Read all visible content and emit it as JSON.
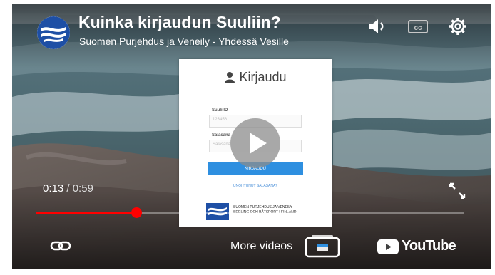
{
  "video": {
    "title": "Kuinka kirjaudun Suuliin?",
    "channel": "Suomen Purjehdus ja Veneily - Yhdessä Vesille"
  },
  "login_card": {
    "heading": "Kirjaudu",
    "field1_label": "Suuli ID",
    "field1_value": "123456",
    "field2_label": "Salasana",
    "field2_placeholder": "Salasana",
    "submit_label": "KIRJAUDU",
    "forgot_link": "UNOHTUNUT SALASANA?",
    "footer_line1": "SUOMEN PURJEHDUS JA VENEILY",
    "footer_line2": "SEGLING OCH BÅTSPORT I FINLAND"
  },
  "player": {
    "current_time": "0:13",
    "separator": " / ",
    "duration": "0:59",
    "progress_fraction": 0.234,
    "more_videos_label": "More videos",
    "youtube_label": "YouTube",
    "accent_color": "#ff0000"
  },
  "icons": {
    "volume": "volume-icon",
    "captions": "cc",
    "settings": "gear-icon",
    "play": "play-icon",
    "fullscreen": "fullscreen-icon",
    "link": "link-icon",
    "more": "more-videos-icon"
  }
}
